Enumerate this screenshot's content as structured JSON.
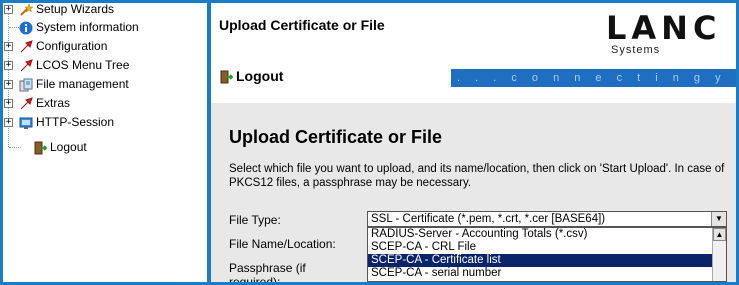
{
  "tree": {
    "items": [
      {
        "label": "Setup Wizards",
        "icon": "wand-icon",
        "expander": "+"
      },
      {
        "label": "System information",
        "icon": "info-icon",
        "expander": ""
      },
      {
        "label": "Configuration",
        "icon": "arrow-icon",
        "expander": "+"
      },
      {
        "label": "LCOS Menu Tree",
        "icon": "arrow-icon",
        "expander": "+"
      },
      {
        "label": "File management",
        "icon": "file-management-icon",
        "expander": "+"
      },
      {
        "label": "Extras",
        "icon": "arrow-icon",
        "expander": "+"
      },
      {
        "label": "HTTP-Session",
        "icon": "session-icon",
        "expander": "+"
      },
      {
        "label": "Logout",
        "icon": "logout-icon",
        "expander": ""
      }
    ]
  },
  "header": {
    "title": "Upload Certificate or File",
    "logo_text": "LANC",
    "logo_sub": "Systems",
    "logout_label": "Logout",
    "banner_text": ". . .   c o n n e c t i n g   y o u r   b"
  },
  "content": {
    "heading": "Upload Certificate or File",
    "description": "Select which file you want to upload, and its name/location, then click on 'Start Upload'. In case of PKCS12 files, a passphrase may be necessary.",
    "file_type_label": "File Type:",
    "file_name_label": "File Name/Location:",
    "passphrase_label": "Passphrase (if required):",
    "file_type_value": "SSL - Certificate (*.pem, *.crt, *.cer [BASE64])",
    "dropdown_options": [
      "RADIUS-Server - Accounting Totals (*.csv)",
      "SCEP-CA - CRL File",
      "SCEP-CA - Certificate list",
      "SCEP-CA - serial number"
    ],
    "selected_option_index": 2
  },
  "colors": {
    "frame": "#1a7bc6",
    "banner_bg": "#1f6ec0",
    "selection": "#0a246a",
    "content_bg": "#e8e8e8"
  }
}
